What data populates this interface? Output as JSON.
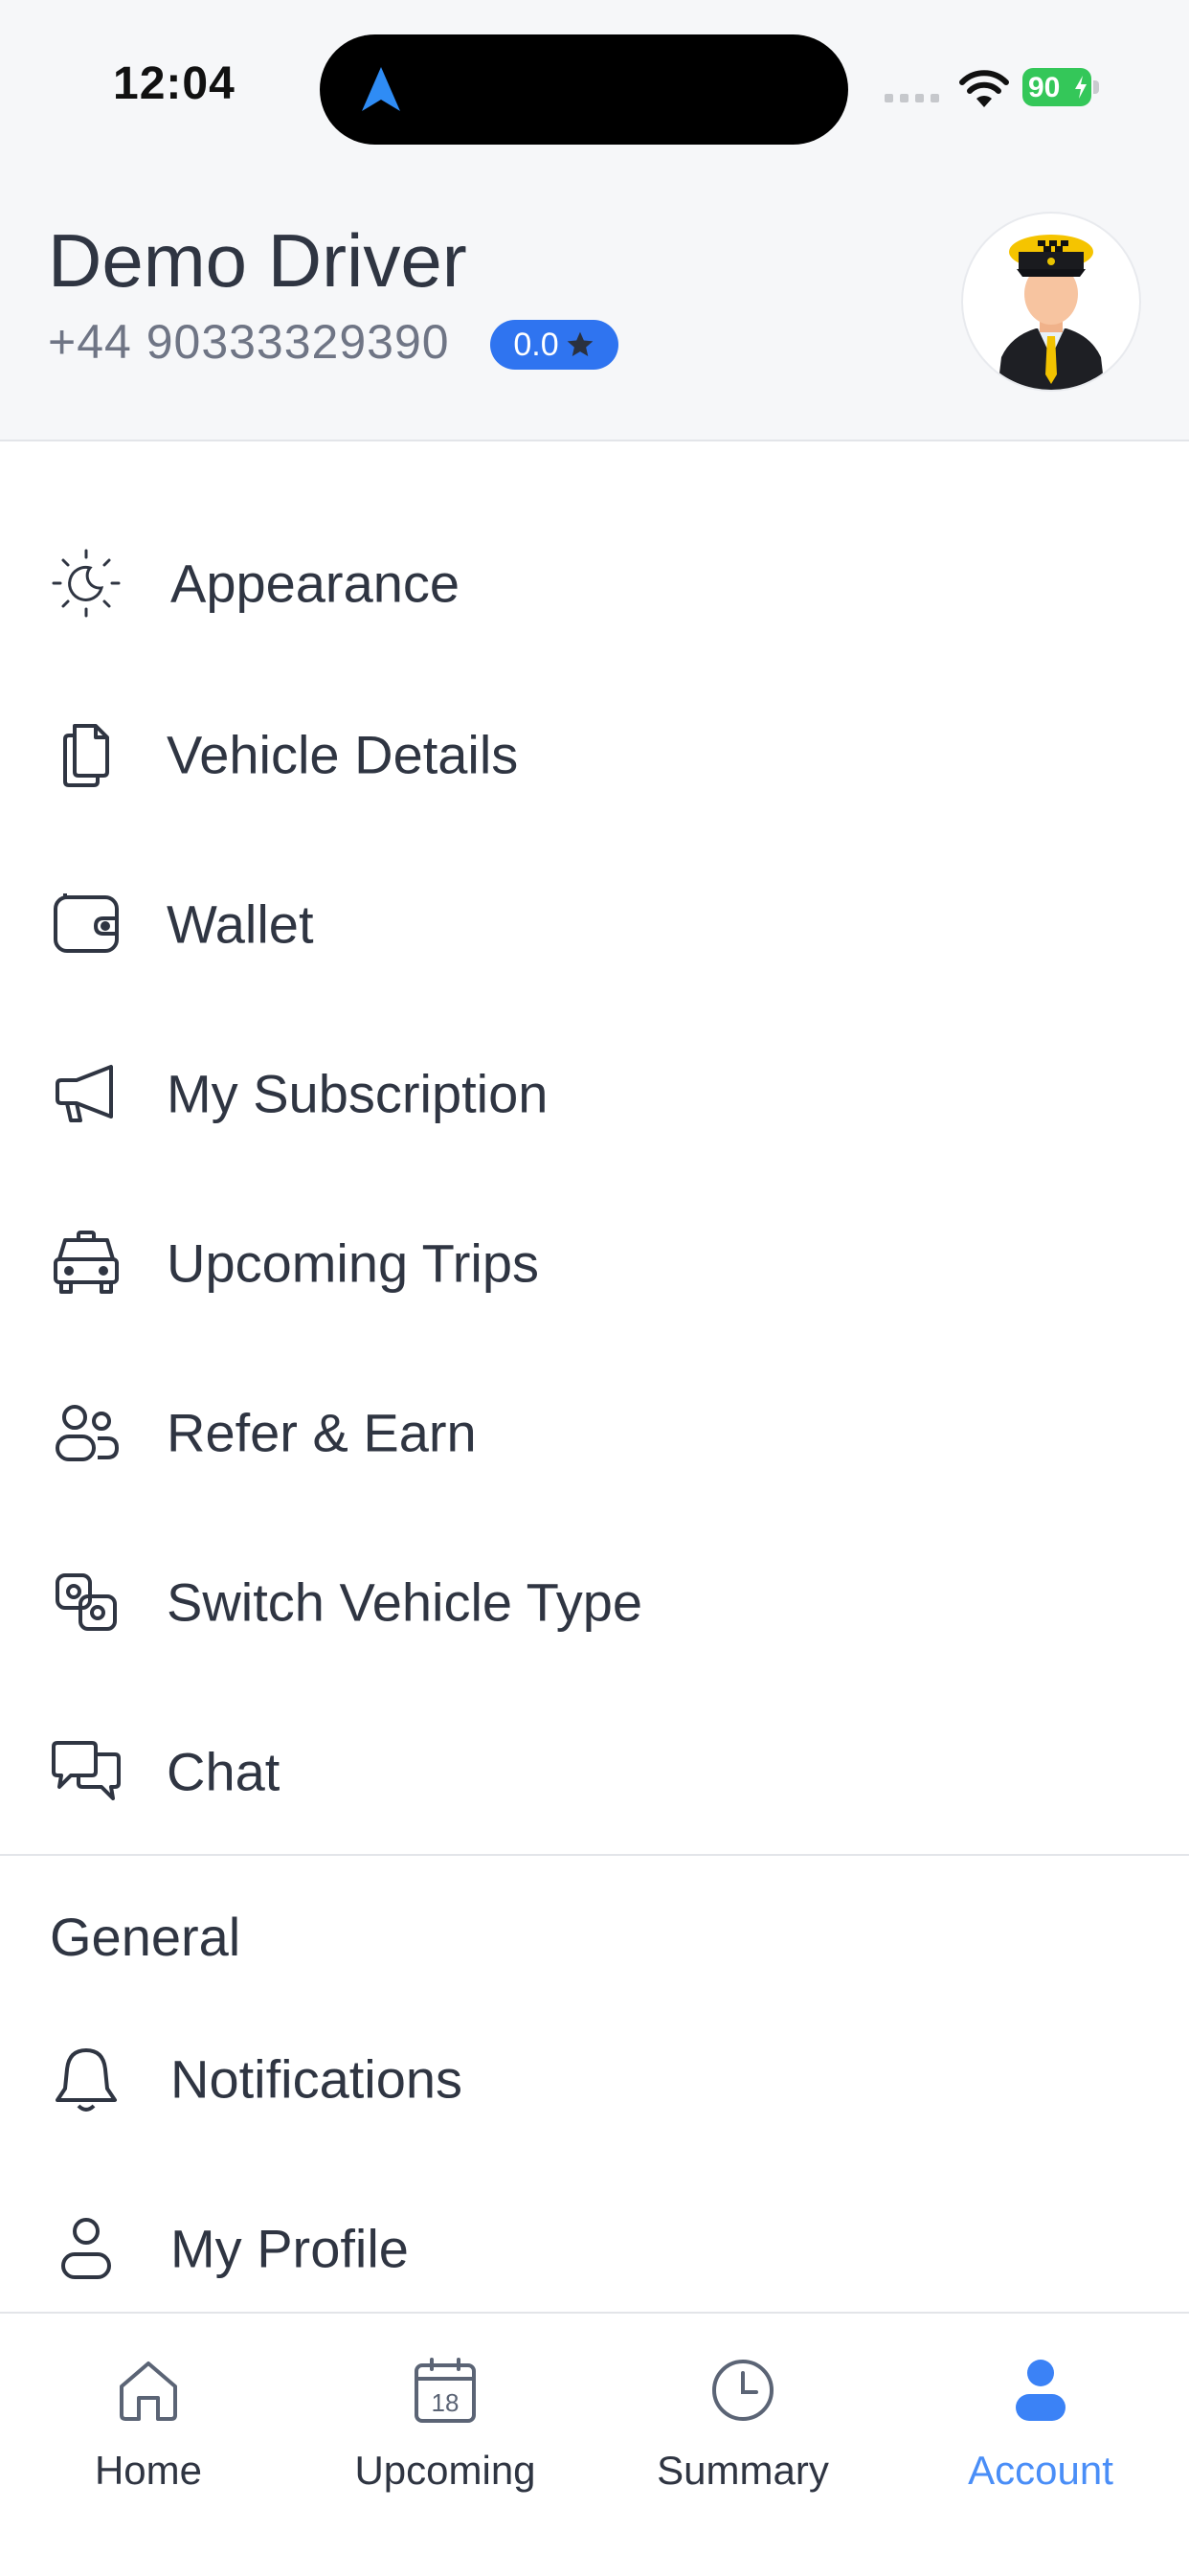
{
  "status_bar": {
    "time": "12:04",
    "battery": "90"
  },
  "profile": {
    "name": "Demo Driver",
    "phone": "+44 90333329390",
    "rating": "0.0"
  },
  "menu": {
    "items": [
      {
        "label": "Appearance",
        "icon": "appearance-icon"
      },
      {
        "label": "Vehicle Details",
        "icon": "document-icon"
      },
      {
        "label": "Wallet",
        "icon": "wallet-icon"
      },
      {
        "label": "My Subscription",
        "icon": "megaphone-icon"
      },
      {
        "label": "Upcoming Trips",
        "icon": "taxi-icon"
      },
      {
        "label": "Refer & Earn",
        "icon": "users-icon"
      },
      {
        "label": "Switch Vehicle Type",
        "icon": "switch-icon"
      },
      {
        "label": "Chat",
        "icon": "chat-icon"
      }
    ],
    "general_title": "General",
    "general_items": [
      {
        "label": "Notifications",
        "icon": "bell-icon"
      },
      {
        "label": "My Profile",
        "icon": "user-icon"
      }
    ]
  },
  "tabs": [
    {
      "label": "Home",
      "icon": "home-icon"
    },
    {
      "label": "Upcoming",
      "icon": "calendar-icon",
      "day": "18"
    },
    {
      "label": "Summary",
      "icon": "clock-icon"
    },
    {
      "label": "Account",
      "icon": "account-icon",
      "active": true
    }
  ],
  "colors": {
    "accent": "#2f74f0",
    "active_tab": "#4a8ef7",
    "text": "#2f3542"
  }
}
